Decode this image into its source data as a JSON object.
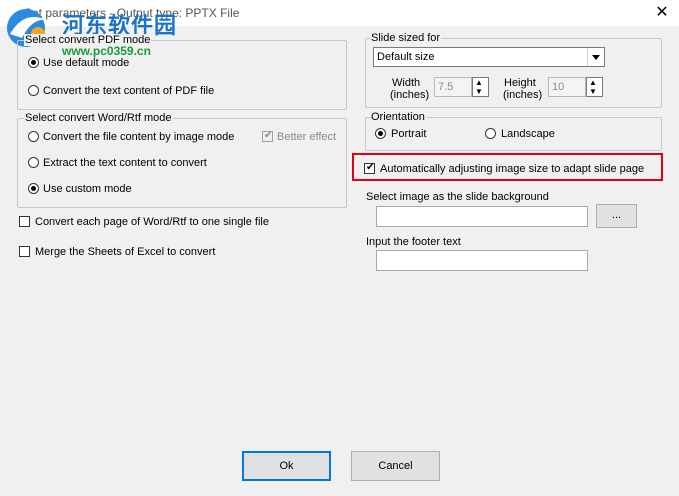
{
  "window": {
    "title": "Set parameters - Output type: PPTX File",
    "close_label": "✕"
  },
  "watermark": {
    "site_name": "河东软件园",
    "url": "www.pc0359.cn"
  },
  "pdf_mode": {
    "legend": "Select convert PDF mode",
    "options": [
      {
        "label": "Use default mode",
        "selected": true
      },
      {
        "label": "Convert the text content of PDF file",
        "selected": false
      }
    ]
  },
  "word_mode": {
    "legend": "Select convert Word/Rtf mode",
    "options": [
      {
        "label": "Convert the file content by image mode",
        "selected": false
      },
      {
        "label": "Extract the text content to convert",
        "selected": false
      },
      {
        "label": "Use custom mode",
        "selected": true
      }
    ],
    "better_effect_label": "Better effect",
    "better_effect_checked": true
  },
  "convert_each_page": {
    "label": "Convert each page of Word/Rtf to one single file",
    "checked": false
  },
  "merge_sheets": {
    "label": "Merge the Sheets of Excel to convert",
    "checked": false
  },
  "slide_size": {
    "legend": "Slide sized for",
    "selected": "Default size",
    "width_label_line1": "Width",
    "width_label_line2": "(inches)",
    "width_value": "7.5",
    "height_label_line1": "Height",
    "height_label_line2": "(inches)",
    "height_value": "10"
  },
  "orientation": {
    "legend": "Orientation",
    "options": [
      {
        "label": "Portrait",
        "selected": true
      },
      {
        "label": "Landscape",
        "selected": false
      }
    ]
  },
  "auto_adjust": {
    "label": "Automatically adjusting image size to adapt slide page",
    "checked": true
  },
  "background": {
    "label": "Select image as the slide background",
    "value": "",
    "browse_label": "..."
  },
  "footer": {
    "label": "Input the footer text",
    "value": ""
  },
  "buttons": {
    "ok_label": "Ok",
    "cancel_label": "Cancel"
  },
  "colors": {
    "highlight_border": "#e0001b",
    "watermark_blue": "#1d73c7",
    "watermark_green": "#1a9b3a"
  }
}
